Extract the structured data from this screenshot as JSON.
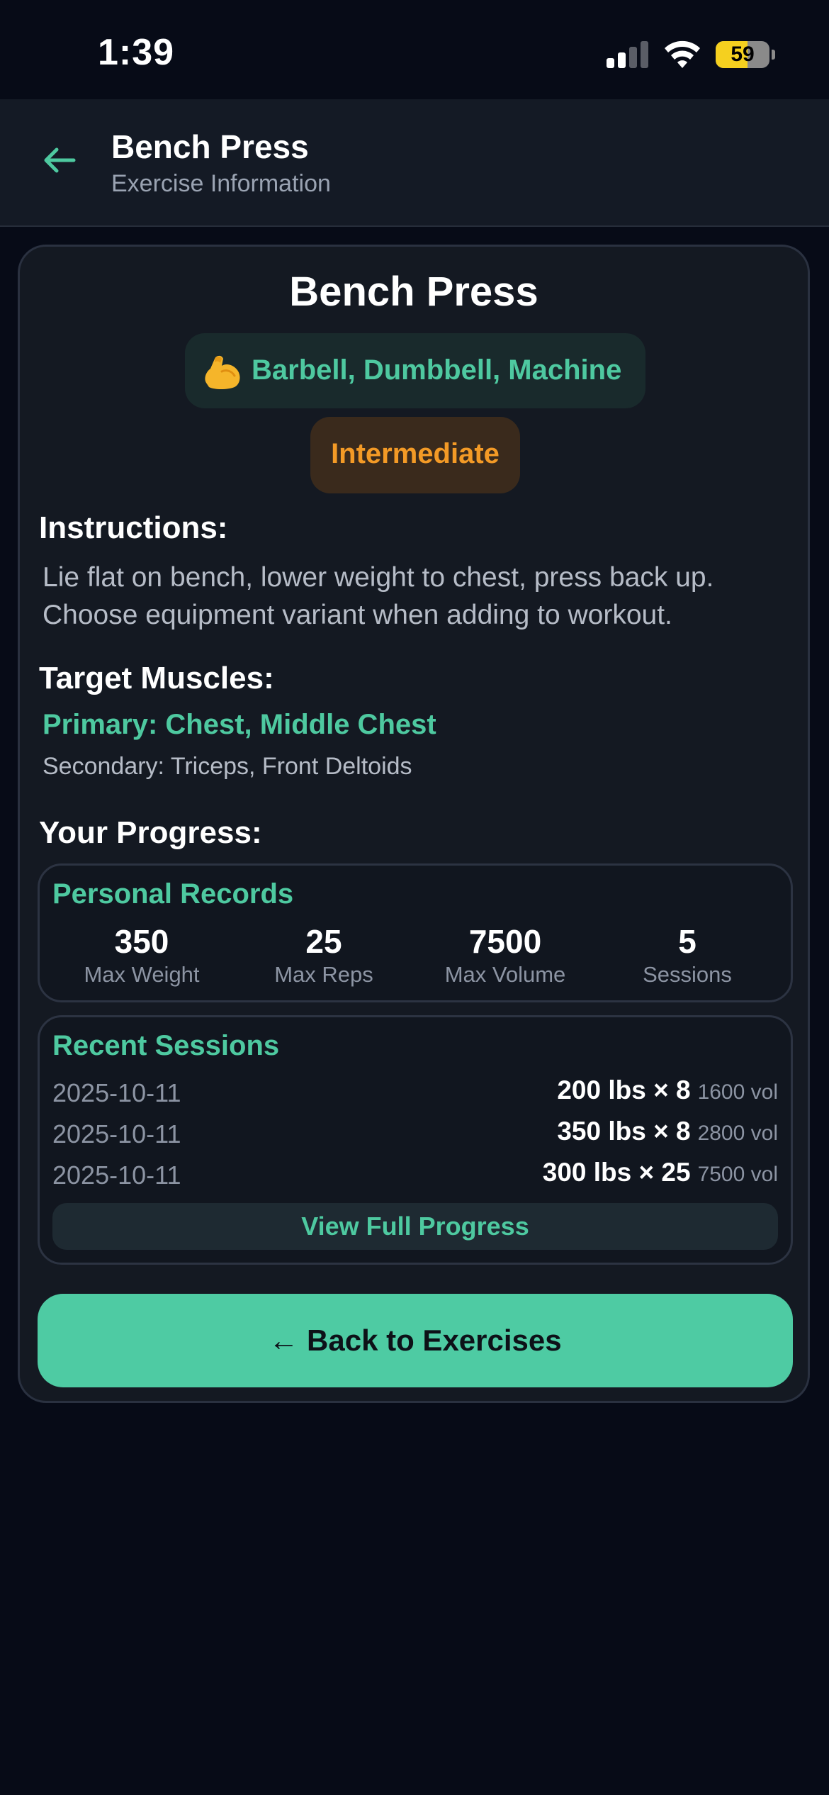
{
  "status_bar": {
    "time": "1:39",
    "battery_percent": "59",
    "battery_level": 0.59,
    "signal_bars_filled": 2
  },
  "header": {
    "title": "Bench Press",
    "subtitle": "Exercise Information"
  },
  "exercise": {
    "title": "Bench Press",
    "equipment_icon": "flexed-biceps-icon",
    "equipment": "Barbell, Dumbbell, Machine",
    "difficulty": "Intermediate",
    "instructions_heading": "Instructions:",
    "instructions": "Lie flat on bench, lower weight to chest, press back up. Choose equipment variant when adding to workout.",
    "target_heading": "Target Muscles:",
    "primary_muscles": "Primary: Chest, Middle Chest",
    "secondary_muscles": "Secondary: Triceps, Front Deltoids"
  },
  "progress": {
    "heading": "Your Progress:",
    "records": {
      "heading": "Personal Records",
      "stats": [
        {
          "value": "350",
          "label": "Max Weight"
        },
        {
          "value": "25",
          "label": "Max Reps"
        },
        {
          "value": "7500",
          "label": "Max Volume"
        },
        {
          "value": "5",
          "label": "Sessions"
        }
      ]
    },
    "recent": {
      "heading": "Recent Sessions",
      "sessions": [
        {
          "date": "2025-10-11",
          "weight_reps": "200 lbs × 8",
          "volume": "1600 vol"
        },
        {
          "date": "2025-10-11",
          "weight_reps": "350 lbs × 8",
          "volume": "2800 vol"
        },
        {
          "date": "2025-10-11",
          "weight_reps": "300 lbs × 25",
          "volume": "7500 vol"
        }
      ],
      "view_full_label": "View Full Progress"
    }
  },
  "back_button_label": "← Back to Exercises",
  "colors": {
    "accent": "#4ec9a0",
    "difficulty": "#f39a26",
    "background": "#070b17",
    "card": "#141922"
  }
}
